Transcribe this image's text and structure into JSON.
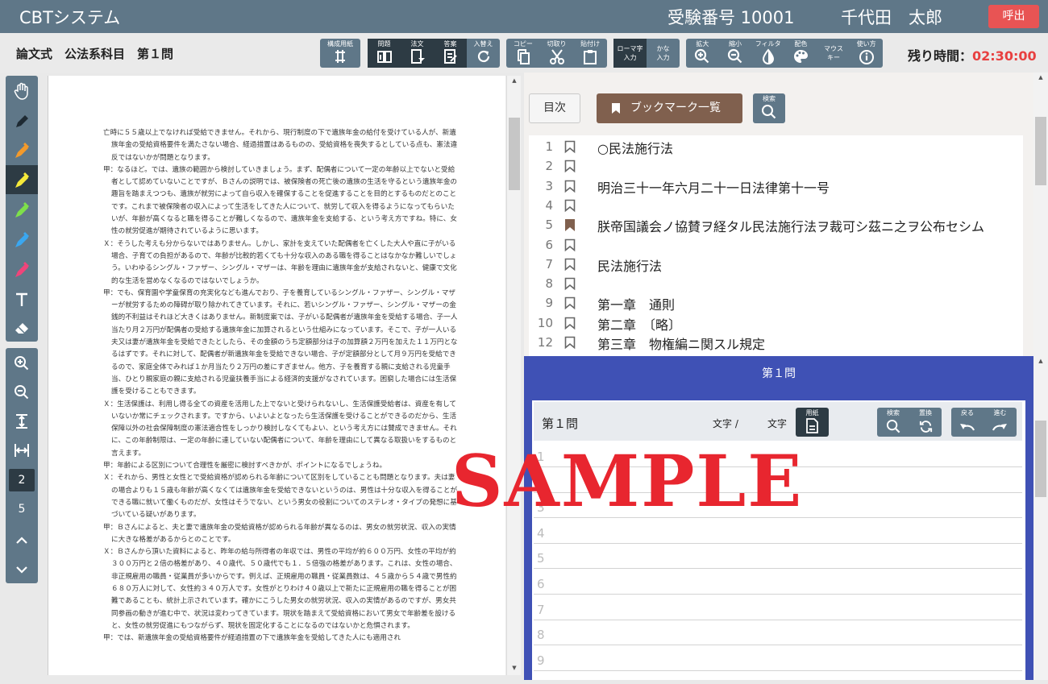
{
  "header": {
    "app_name": "CBTシステム",
    "exam_number": "受験番号 10001",
    "user_name": "千代田　太郎",
    "call_button": "呼出"
  },
  "toolbar": {
    "breadcrumb": "論文式　公法系科目　第１問",
    "layout_paper": "構成用紙",
    "problem": "問題",
    "law_text": "法文",
    "answer": "答案",
    "swap": "入替え",
    "copy": "コピー",
    "cut": "切取り",
    "paste": "貼付け",
    "romaji_line1": "ローマ字",
    "romaji_line2": "入力",
    "kana_line1": "かな",
    "kana_line2": "入力",
    "zoom_in": "拡大",
    "zoom_out": "縮小",
    "filter": "フィルタ",
    "color": "配色",
    "mouse_line1": "マウス",
    "mouse_line2": "キー",
    "help": "使い方",
    "timer_label": "残り時間：",
    "timer_value": "02:30:00"
  },
  "side_tools": [
    "hand",
    "pen",
    "highlighter-orange",
    "highlighter-yellow",
    "highlighter-green",
    "highlighter-blue",
    "highlighter-pink",
    "text",
    "eraser"
  ],
  "nav_tools": {
    "current_page": "2",
    "total_pages": "5"
  },
  "document": {
    "paragraphs": [
      "亡時に５５歳以上でなければ受給できません。それから、現行制度の下で遺族年金の給付を受けている人が、新遺族年金の受給資格要件を満たさない場合、経過措置はあるものの、受給資格を喪失するとしている点も、憲法違反ではないかが問題となります。",
      "甲：なるほど。では、遺族の範囲から検討していきましょう。まず、配偶者について一定の年齢以上でないと受給者として認めていないことですが、Ｂさんの説明では、被保険者の死亡後の遺族の生活を守るという遺族年金の趣旨を踏まえつつも、遺族が就労によって自ら収入を確保することを促進することを目的とするものだとのことです。これまで被保険者の収入によって生活をしてきた人について、就労して収入を得るようになってもらいたいが、年齢が高くなると職を得ることが難しくなるので、遺族年金を支給する、という考え方ですね。特に、女性の就労促進が期待されているように思います。",
      "Ｘ：そうした考えも分からないではありません。しかし、家計を支えていた配偶者を亡くした大人や直に子がいる場合、子育ての負担があるので、年齢が比較的若くても十分な収入のある職を得ることはなかなか難しいでしょう。いわゆるシングル・ファザー、シングル・マザーは、年齢を理由に遺族年金が支給されないと、健康で文化的な生活を営めなくなるのではないでしょうか。",
      "甲：でも、保育園や学童保育の充実化なども進んでおり、子を養育しているシングル・ファザー、シングル・マザーが就労するための障碍が取り除かれてきています。それに、若いシングル・ファザー、シングル・マザーの金銭的不利益はそれほど大きくはありません。新制度案では、子がいる配偶者が遺族年金を受給する場合、子一人当たり月２万円が配偶者の受給する遺族年金に加算されるという仕組みになっています。そこで、子が一人いる夫又は妻が遺族年金を受給できたとしたら、その金額のうち定額部分は子の加算額２万円を加えた１１万円となるはずです。それに対して、配偶者が新遺族年金を受給できない場合、子が定額部分として月９万円を受給できるので、家庭全体でみれば１か月当たり２万円の差にすぎません。他方、子を養育する親に支給される児童手当、ひとり親家庭の親に支給される児童扶養手当による経済的支援がなされています。困窮した場合には生活保護を受けることもできます。",
      "Ｘ：生活保護は、利用し得る全ての資産を活用した上でないと受けられないし、生活保護受給者は、資産を有していないか常にチェックされます。ですから、いよいよとなったら生活保護を受けることができるのだから、生活保障以外の社会保障制度の憲法適合性をしっかり検討しなくてもよい、という考え方には賛成できません。それに、この年齢制限は、一定の年齢に達していない配偶者について、年齢を理由にして異なる取扱いをするものと言えます。",
      "甲：年齢による区別について合理性を厳密に検討すべきかが、ポイントになるでしょうね。",
      "Ｘ：それから、男性と女性とで受給資格が認められる年齢について区別をしていることも問題となります。夫は妻の場合よりも１５歳も年齢が高くなくては遺族年金を受給できないというのは、男性は十分な収入を得ることができる職に就いて働くものだが、女性はそうでない、という男女の役割についてのステレオ・タイプの発想に基づいている疑いがあります。",
      "甲：Ｂさんによると、夫と妻で遺族年金の受給資格が認められる年齢が異なるのは、男女の就労状況、収入の実情に大きな格差があるからとのことです。",
      "Ｘ：Ｂさんから頂いた資料によると、昨年の給与所得者の年収では、男性の平均が約６００万円、女性の平均が約３００万円と２倍の格差があり、４０歳代、５０歳代でも１．５倍強の格差があります。これは、女性の場合、非正規雇用の職員・従業員が多いからです。例えば、正規雇用の職員・従業員数は、４５歳から５４歳で男性約６８０万人に対して、女性約３４０万人です。女性がとりわけ４０歳以上で新たに正規雇用の職を得ることが困難であることも、統計上示されています。確かにこうした男女の就労状況、収入の実情があるのですが、男女共同参画の動きが進む中で、状況は変わってきています。現状を踏まえて受給資格において男女で年齢差を設けると、女性の就労促進にもつながらず、現状を固定化することになるのではないかと危惧されます。",
      "甲：では、新遺族年金の受給資格要件が経過措置の下で遺族年金を受給してきた人にも適用され"
    ]
  },
  "law_panel": {
    "toc_button": "目次",
    "bookmark_button": "ブックマーク一覧",
    "search_label": "検索",
    "rows": [
      {
        "no": "1",
        "text": "○民法施行法",
        "bookmarked": false
      },
      {
        "no": "2",
        "text": "",
        "bookmarked": false
      },
      {
        "no": "3",
        "text": "明治三十一年六月二十一日法律第十一号",
        "bookmarked": false
      },
      {
        "no": "4",
        "text": "",
        "bookmarked": false
      },
      {
        "no": "5",
        "text": "朕帝国議会ノ協賛ヲ経タル民法施行法ヲ裁可シ茲ニ之ヲ公布セシム",
        "bookmarked": true
      },
      {
        "no": "6",
        "text": "",
        "bookmarked": false
      },
      {
        "no": "7",
        "text": "民法施行法",
        "bookmarked": false
      },
      {
        "no": "8",
        "text": "",
        "bookmarked": false
      },
      {
        "no": "9",
        "text": "第一章　通則",
        "bookmarked": false
      },
      {
        "no": "10",
        "text": "第二章　〔略〕",
        "bookmarked": false
      },
      {
        "no": "12",
        "text": "第三章　物権編ニ関スル規定",
        "bookmarked": false
      }
    ]
  },
  "answer_panel": {
    "title": "第１問",
    "inner_title": "第１問",
    "char_count_label": "文字 /",
    "char_unit_label": "文字",
    "paper_label": "用紙",
    "search_label": "検索",
    "replace_label": "置換",
    "undo_label": "戻る",
    "redo_label": "進む",
    "line_numbers": [
      "1",
      "2",
      "3",
      "4",
      "5",
      "6",
      "7",
      "8",
      "9"
    ]
  },
  "watermark": "SAMPLE",
  "colors": {
    "header": "#5f7788",
    "dark_button": "#2d3b44",
    "timer": "#e84040",
    "call": "#e85454",
    "bookmark_button": "#80604e",
    "answer_panel": "#3f51b5",
    "watermark": "#e8262f"
  }
}
